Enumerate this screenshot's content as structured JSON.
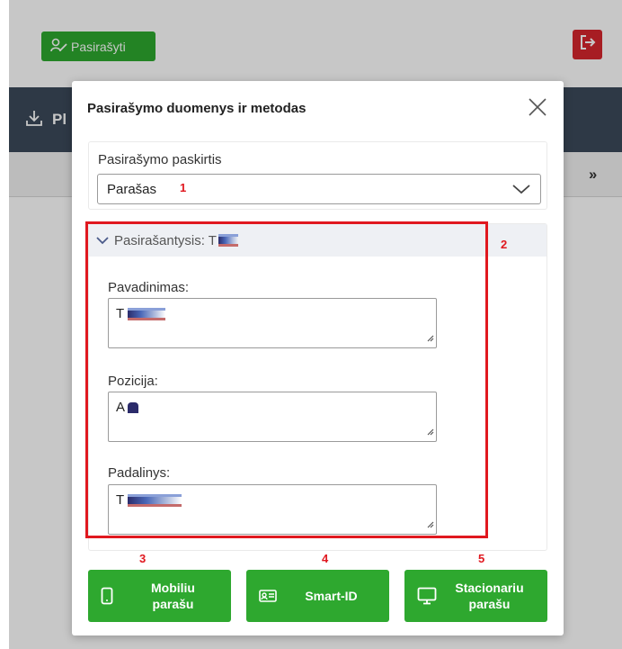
{
  "app": {
    "sign_button_label": "Pasirašyti",
    "toolbar_title_partial": "Pl",
    "breadcrumb_chevron": "››"
  },
  "modal": {
    "title": "Pasirašymo duomenys ir metodas",
    "purpose": {
      "label": "Pasirašymo paskirtis",
      "selected_value": "Parašas"
    },
    "signer": {
      "header_label": "Pasirašantysis: T",
      "fields": [
        {
          "label": "Pavadinimas:",
          "value": "T"
        },
        {
          "label": "Pozicija:",
          "value": "A"
        },
        {
          "label": "Padalinys:",
          "value": "T"
        }
      ]
    },
    "methods": [
      {
        "label_line1": "Mobiliu",
        "label_line2": "parašu",
        "icon": "mobile-phone-icon"
      },
      {
        "label_line1": "Smart-ID",
        "label_line2": "",
        "icon": "id-card-icon"
      },
      {
        "label_line1": "Stacionariu",
        "label_line2": "parašu",
        "icon": "desktop-monitor-icon"
      }
    ]
  },
  "annotations": [
    "1",
    "2",
    "3",
    "4",
    "5"
  ],
  "colors": {
    "accent_green": "#2ea82f",
    "logout_red": "#d7262d",
    "header_dark": "#3b4a5a",
    "annotation_red": "#e0181f"
  }
}
